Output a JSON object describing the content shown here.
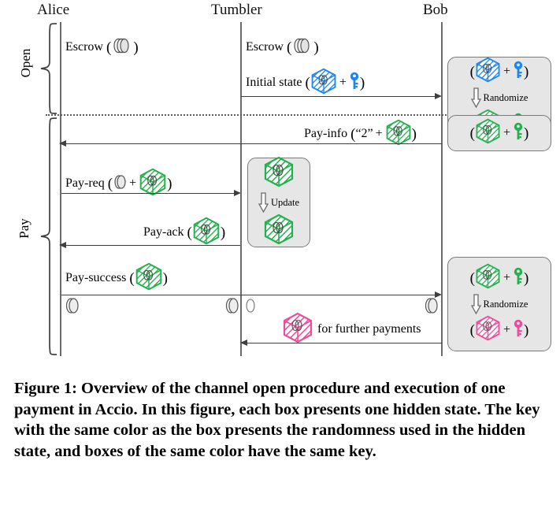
{
  "figure": {
    "caption": "Figure 1: Overview of the channel open procedure and execution of one payment in Accio. In this figure, each box presents one hidden state. The key with the same color as the box presents the randomness used in the hidden state, and boxes of the same color have the same key."
  },
  "colors": {
    "blue": "#1b86f0",
    "green": "#22b14c",
    "pink": "#ef4a9b",
    "coin_grey": "#d8d8d8",
    "panel_fill": "#e6e6e6",
    "panel_border": "#7a7a7a",
    "line": "#3f3f3f",
    "lifeline": "#6b6b6b"
  },
  "actors": [
    {
      "id": "alice",
      "label": "Alice"
    },
    {
      "id": "tumbler",
      "label": "Tumbler"
    },
    {
      "id": "bob",
      "label": "Bob"
    }
  ],
  "phases": [
    {
      "id": "open",
      "label": "Open"
    },
    {
      "id": "pay",
      "label": "Pay"
    }
  ],
  "messages": [
    {
      "id": "escrow-alice",
      "phase": "open",
      "text_before": "Escrow",
      "open_paren": "(",
      "icons": [
        "coin-stack-icon"
      ],
      "close_paren": ")"
    },
    {
      "id": "escrow-tumbler",
      "phase": "open",
      "text_before": "Escrow",
      "open_paren": "(",
      "icons": [
        "coin-stack-icon"
      ],
      "close_paren": ")"
    },
    {
      "id": "initial-state",
      "phase": "open",
      "text_before": "Initial state",
      "open_paren": "(",
      "icons": [
        "blue-box-icon",
        "blue-key-icon"
      ],
      "plus": "+",
      "close_paren": ")",
      "direction": "tumbler-to-bob"
    },
    {
      "id": "pay-info",
      "phase": "pay",
      "text_before": "Pay-info",
      "open_paren": "(",
      "quoted_value": "“2”",
      "plus": "+",
      "icons": [
        "green-box-icon"
      ],
      "close_paren": ")",
      "direction": "bob-to-alice"
    },
    {
      "id": "pay-req",
      "phase": "pay",
      "text_before": "Pay-req",
      "open_paren": "(",
      "icons": [
        "coin-icon",
        "green-box-icon"
      ],
      "plus": "+",
      "close_paren": ")",
      "direction": "alice-to-tumbler"
    },
    {
      "id": "pay-ack",
      "phase": "pay",
      "text_before": "Pay-ack",
      "open_paren": "(",
      "icons": [
        "green-box-icon"
      ],
      "close_paren": ")",
      "direction": "tumbler-to-alice"
    },
    {
      "id": "pay-success",
      "phase": "pay",
      "text_before": "Pay-success",
      "open_paren": "(",
      "icons": [
        "green-box-icon"
      ],
      "close_paren": ")",
      "direction": "alice-to-bob"
    },
    {
      "id": "further-payments",
      "phase": "pay",
      "icons": [
        "pink-box-icon"
      ],
      "text_after": "for further payments",
      "direction": "bob-to-tumbler"
    }
  ],
  "panels": [
    {
      "id": "bob-open-panel",
      "owner": "bob",
      "top_row": {
        "open_paren": "(",
        "box": "blue-box-icon",
        "plus": "+",
        "key": "blue-key-icon",
        "close_paren": ")"
      },
      "operation": {
        "label": "Randomize",
        "arrow": "down-block-arrow-icon"
      },
      "bottom_row": {
        "open_paren": "(",
        "box": "green-box-icon",
        "plus": "+",
        "key": "green-key-icon",
        "close_paren": ")"
      }
    },
    {
      "id": "tumbler-update-panel",
      "owner": "tumbler",
      "top_row": {
        "box": "green-box-icon"
      },
      "operation": {
        "label": "Update",
        "arrow": "down-block-arrow-icon"
      },
      "bottom_row": {
        "box": "green-box-icon"
      }
    },
    {
      "id": "bob-pay-panel",
      "owner": "bob",
      "top_row": {
        "open_paren": "(",
        "box": "green-box-icon",
        "plus": "+",
        "key": "green-key-icon",
        "close_paren": ")"
      },
      "operation": {
        "label": "Randomize",
        "arrow": "down-block-arrow-icon"
      },
      "bottom_row": {
        "open_paren": "(",
        "box": "pink-box-icon",
        "plus": "+",
        "key": "pink-key-icon",
        "close_paren": ")"
      }
    }
  ],
  "settled_coins": [
    {
      "id": "coin-alice",
      "icon": "coin-icon"
    },
    {
      "id": "coin-tumbler-left",
      "icon": "coin-icon"
    },
    {
      "id": "coin-tumbler-right",
      "icon": "coin-outline-icon"
    },
    {
      "id": "coin-bob",
      "icon": "coin-icon"
    }
  ]
}
